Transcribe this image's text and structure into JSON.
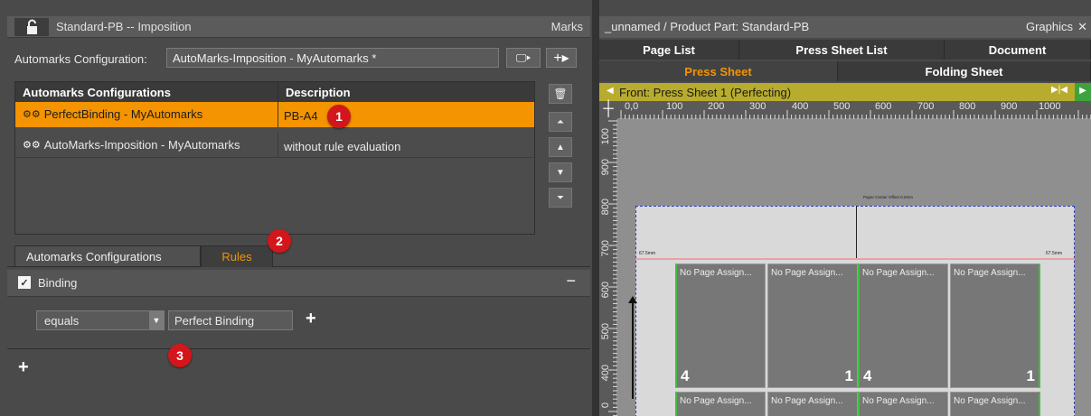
{
  "left_panel": {
    "title": "Standard-PB -- Imposition",
    "marks_label": "Marks",
    "config_label": "Automarks Configuration:",
    "config_value": "AutoMarks-Imposition - MyAutomarks *",
    "table": {
      "headers": [
        "Automarks Configurations",
        "Description"
      ],
      "rows": [
        {
          "name": "PerfectBinding - MyAutomarks",
          "description": "PB-A4",
          "selected": true
        },
        {
          "name": "AutoMarks-Imposition - MyAutomarks",
          "description": "without rule evaluation",
          "selected": false
        }
      ]
    },
    "tabs": [
      "Automarks Configurations",
      "Rules"
    ],
    "active_tab": "Rules",
    "rule": {
      "label": "Binding",
      "checked": true,
      "operator": "equals",
      "value": "Perfect Binding"
    }
  },
  "badges": [
    "1",
    "2",
    "3"
  ],
  "right_panel": {
    "title": "_unnamed / Product Part: Standard-PB",
    "graphics_label": "Graphics",
    "tabs_row1": [
      "Page List",
      "Press Sheet List",
      "Document"
    ],
    "tabs_row2": [
      "Press Sheet",
      "Folding Sheet"
    ],
    "active_tab": "Press Sheet",
    "sheet_label": "Front: Press Sheet 1 (Perfecting)",
    "h_ruler_ticks": [
      "0,0",
      "100",
      "200",
      "300",
      "400",
      "500",
      "600",
      "700",
      "800",
      "900",
      "1000"
    ],
    "v_ruler_ticks": [
      "100",
      "900",
      "800",
      "700",
      "600",
      "500",
      "400",
      "0"
    ],
    "paper_center": "Paper Center Offset 0.0mm",
    "page_label": "No Page Assign...",
    "page_numbers": [
      "4",
      "1",
      "4",
      "1"
    ],
    "margin_labels": [
      "67.5mm",
      "67.5mm"
    ]
  },
  "colors": {
    "accent": "#f39400",
    "badge": "#d3161b",
    "sheet_bar": "#b8ac2e"
  }
}
